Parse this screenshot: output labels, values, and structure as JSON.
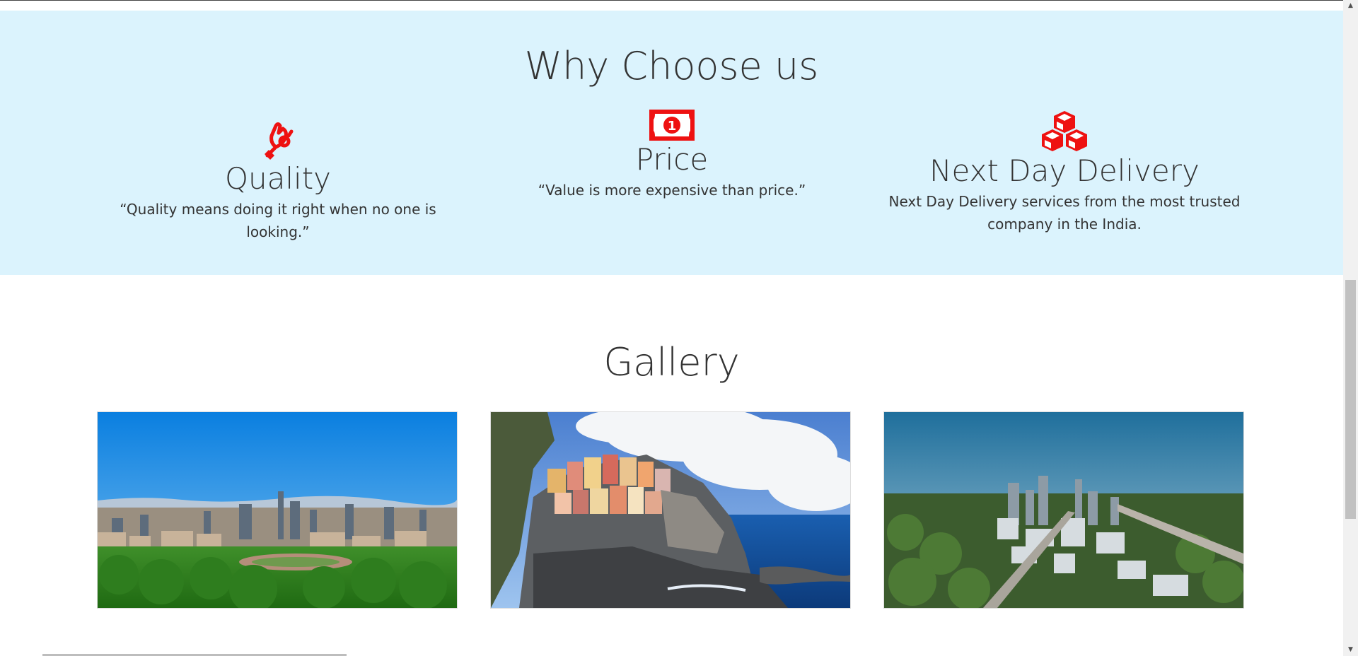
{
  "why_section": {
    "title": "Why Choose us",
    "background": "#dbf3fd",
    "accent_icon_color": "#ee1111",
    "features": [
      {
        "icon": "ok-hand-icon",
        "title": "Quality",
        "text": "“Quality means doing it right when no one is looking.”"
      },
      {
        "icon": "money-bill-icon",
        "title": "Price",
        "text": "“Value is more expensive than price.”"
      },
      {
        "icon": "cubes-icon",
        "title": "Next Day Delivery",
        "text": "Next Day Delivery services from the most trusted company in the India."
      }
    ]
  },
  "gallery": {
    "title": "Gallery",
    "images": [
      {
        "icon": "city-skyline-photo"
      },
      {
        "icon": "coastal-village-photo"
      },
      {
        "icon": "aerial-city-photo"
      }
    ]
  }
}
